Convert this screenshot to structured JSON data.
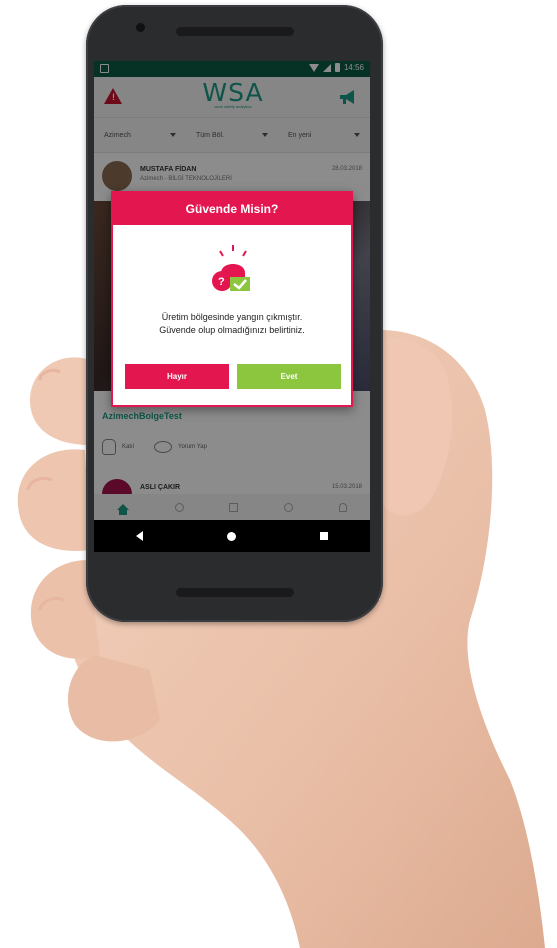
{
  "status_bar": {
    "time": "14:56"
  },
  "app": {
    "logo": "WSA",
    "logo_sub": "work safety analytics"
  },
  "filters": [
    {
      "label": "Azimech"
    },
    {
      "label": "Tüm Böl."
    },
    {
      "label": "En yeni"
    }
  ],
  "posts": [
    {
      "author": "MUSTAFA FİDAN",
      "sub": "Azimech - BİLGİ TEKNOLOJİLERİ",
      "date": "28.03.2018",
      "caption": "AzimechBolgeTest"
    },
    {
      "author": "ASLI ÇAKIR",
      "date": "15.03.2018"
    }
  ],
  "actions": {
    "like": "Katıl",
    "comment": "Yorum Yap"
  },
  "dialog": {
    "title": "Güvende Misin?",
    "message_line1": "Üretim bölgesinde yangın çıkmıştır.",
    "message_line2": "Güvende olup olmadığınızı belirtiniz.",
    "no_label": "Hayır",
    "yes_label": "Evet"
  },
  "colors": {
    "primary": "#e3164f",
    "accent": "#8cc63f",
    "brand": "#1c9a84",
    "statusbar": "#0c5b45"
  }
}
